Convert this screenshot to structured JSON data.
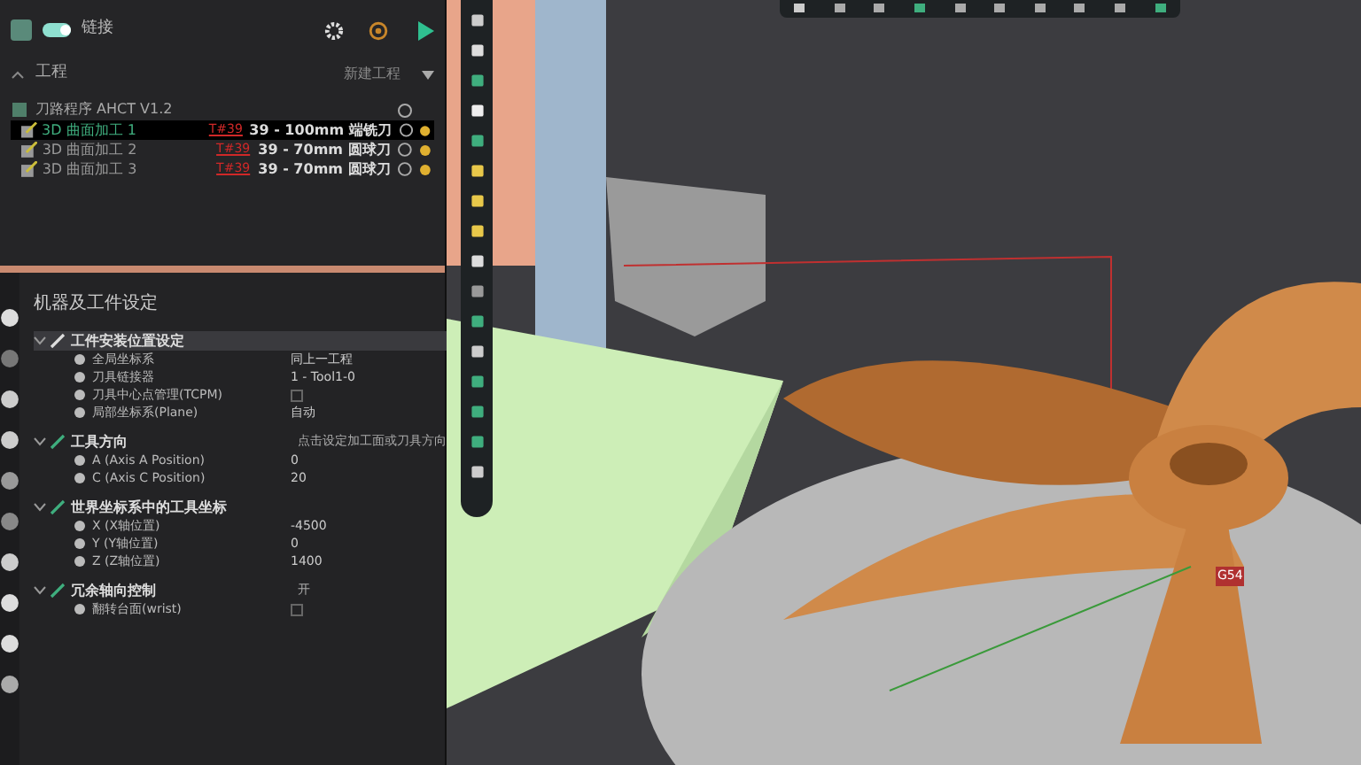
{
  "header": {
    "toggle": {
      "label": "链接",
      "on": true
    }
  },
  "project": {
    "title": "工程",
    "action": "新建工程",
    "program": "刀路程序 AHCT V1.2",
    "operations": [
      {
        "name": "3D 曲面加工 1",
        "tool_tag": "T#39",
        "tool": "39 - 100mm 端铣刀",
        "selected": true
      },
      {
        "name": "3D 曲面加工 2",
        "tool_tag": "T#39",
        "tool": "39 - 70mm 圆球刀",
        "selected": false
      },
      {
        "name": "3D 曲面加工 3",
        "tool_tag": "T#39",
        "tool": "39 - 70mm 圆球刀",
        "selected": false
      }
    ]
  },
  "settings": {
    "title": "机器及工件设定",
    "groups": [
      {
        "label": "工件安装位置设定",
        "expanded": true,
        "selected": true,
        "rows": [
          {
            "label": "全局坐标系",
            "kind": "text",
            "value": "同上一工程"
          },
          {
            "label": "刀具链接器",
            "kind": "text",
            "value": "1 - Tool1-0"
          },
          {
            "label": "刀具中心点管理(TCPM)",
            "kind": "check",
            "checked": false
          },
          {
            "label": "局部坐标系(Plane)",
            "kind": "text",
            "value": "自动"
          }
        ]
      },
      {
        "label": "工具方向",
        "expanded": true,
        "selected": false,
        "value": "点击设定加工面或刀具方向",
        "rows": [
          {
            "label": "A (Axis A Position)",
            "kind": "text",
            "value": "0"
          },
          {
            "label": "C (Axis C Position)",
            "kind": "text",
            "value": "20"
          }
        ]
      },
      {
        "label": "世界坐标系中的工具坐标",
        "expanded": true,
        "selected": false,
        "rows": [
          {
            "label": "X (X轴位置)",
            "kind": "text",
            "value": "-4500"
          },
          {
            "label": "Y (Y轴位置)",
            "kind": "text",
            "value": "0"
          },
          {
            "label": "Z (Z轴位置)",
            "kind": "text",
            "value": "1400"
          }
        ]
      },
      {
        "label": "冗余轴向控制",
        "expanded": true,
        "selected": false,
        "value": "开",
        "rows": [
          {
            "label": "翻转台面(wrist)",
            "kind": "check",
            "checked": false
          }
        ]
      }
    ]
  },
  "viewport": {
    "origin_label": "G54"
  }
}
